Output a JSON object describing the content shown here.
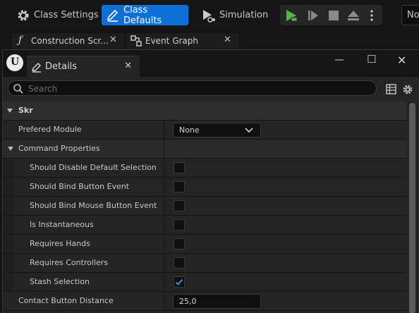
{
  "toolbar": {
    "class_settings": "Class Settings",
    "class_defaults": "Class Defaults",
    "simulation": "Simulation",
    "right_box": "No"
  },
  "tabs": [
    {
      "label": "Construction Scr...",
      "icon": "function-icon"
    },
    {
      "label": "Event Graph",
      "icon": "graph-icon"
    }
  ],
  "window": {
    "tab_label": "Details",
    "search_placeholder": "Search"
  },
  "colors": {
    "accent": "#0e70d6",
    "play_green": "#58b24a",
    "background": "#242424"
  },
  "properties": {
    "category": "Skr",
    "prefered_module": {
      "label": "Prefered Module",
      "value": "None"
    },
    "command_properties": "Command Properties",
    "checks": [
      {
        "label": "Should Disable Default Selection",
        "checked": false
      },
      {
        "label": "Should Bind Button Event",
        "checked": false
      },
      {
        "label": "Should Bind Mouse Button Event",
        "checked": false
      },
      {
        "label": "Is Instantaneous",
        "checked": false
      },
      {
        "label": "Requires Hands",
        "checked": false
      },
      {
        "label": "Requires Controllers",
        "checked": false
      },
      {
        "label": "Stash Selection",
        "checked": true
      }
    ],
    "contact_button_distance": {
      "label": "Contact Button Distance",
      "value": "25,0"
    }
  }
}
